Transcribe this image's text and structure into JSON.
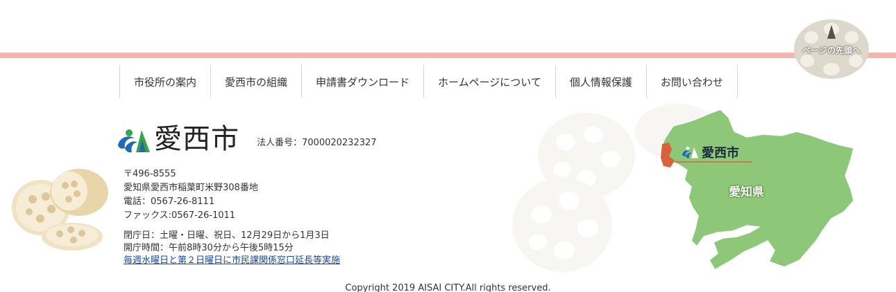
{
  "back_to_top": {
    "label": "ページの先頭へ"
  },
  "nav": {
    "items": [
      {
        "label": "市役所の案内"
      },
      {
        "label": "愛西市の組織"
      },
      {
        "label": "申請書ダウンロード"
      },
      {
        "label": "ホームページについて"
      },
      {
        "label": "個人情報保護"
      },
      {
        "label": "お問い合わせ"
      }
    ]
  },
  "footer": {
    "city_name": "愛西市",
    "corporate_number": "法人番号：7000020232327",
    "postal_code": "〒496-8555",
    "address": "愛知県愛西市稲葉町米野308番地",
    "phone": "電話：0567-26-8111",
    "fax": "ファックス:0567-26-1011",
    "closed_days": "閉庁日：土曜・日曜、祝日、12月29日から1月3日",
    "office_hours": "開庁時間：午前8時30分から午後5時15分",
    "extended_hours_link": "毎週水曜日と第２日曜日に市民課関係窓口延長等実施",
    "copyright": "Copyright 2019 AISAI CITY.All rights reserved."
  },
  "map": {
    "city_label": "愛西市",
    "prefecture_label": "愛知県",
    "prefecture_color": "#8cc878",
    "city_color": "#d9623a"
  },
  "colors": {
    "accent_rule": "#f2b6b0",
    "link": "#1a4aa0"
  },
  "icons": {
    "back_to_top": "lotus-root-arrow-up-icon",
    "logo": "aisai-city-emblem-icon",
    "decoration": "lotus-root-illustration"
  }
}
